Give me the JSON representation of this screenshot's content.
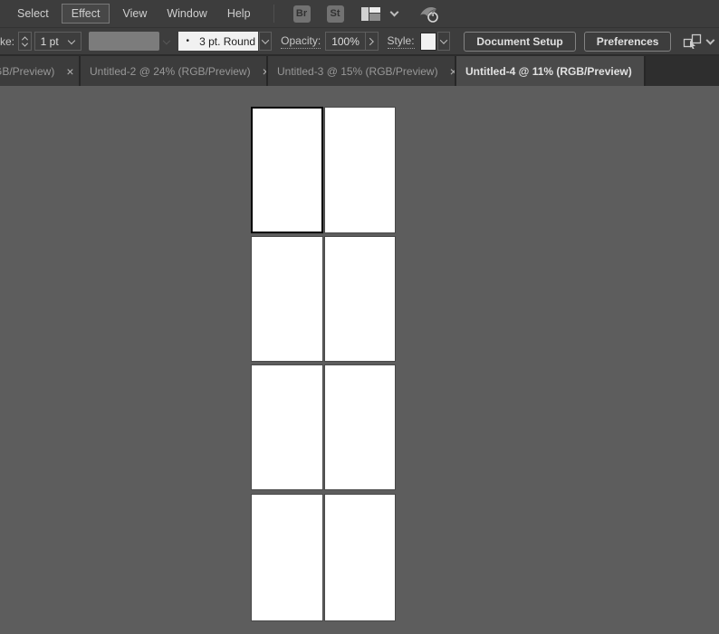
{
  "menu_bar": {
    "items": [
      {
        "label": "Select"
      },
      {
        "label": "Effect"
      },
      {
        "label": "View"
      },
      {
        "label": "Window"
      },
      {
        "label": "Help"
      }
    ],
    "bridge_button_label": "Br",
    "stock_button_label": "St"
  },
  "control_bar": {
    "stroke_label": "ke:",
    "stroke_weight_value": "1 pt",
    "brush_bullet": "•",
    "brush_name": "3 pt. Round",
    "opacity_label": "Opacity:",
    "opacity_value": "100%",
    "style_label": "Style:",
    "document_setup_label": "Document Setup",
    "preferences_label": "Preferences"
  },
  "tab_bar": {
    "close_glyph": "×",
    "tabs": [
      {
        "label": "GB/Preview)",
        "active": false
      },
      {
        "label": "Untitled-2 @ 24% (RGB/Preview)",
        "active": false
      },
      {
        "label": "Untitled-3 @ 15% (RGB/Preview)",
        "active": false
      },
      {
        "label": "Untitled-4 @ 11% (RGB/Preview)",
        "active": true
      }
    ]
  },
  "canvas": {
    "artboard_count": 8,
    "columns": 2,
    "rows": 4,
    "active_artboard_index": 1
  },
  "colors": {
    "ui_bar_bg": "#3d3d3d",
    "tab_bar_bg": "#2e2e2e",
    "active_tab_bg": "#4a4a4a",
    "canvas_bg": "#5d5d5d",
    "artboard_fill": "#ffffff",
    "active_artboard_border": "#000000"
  }
}
